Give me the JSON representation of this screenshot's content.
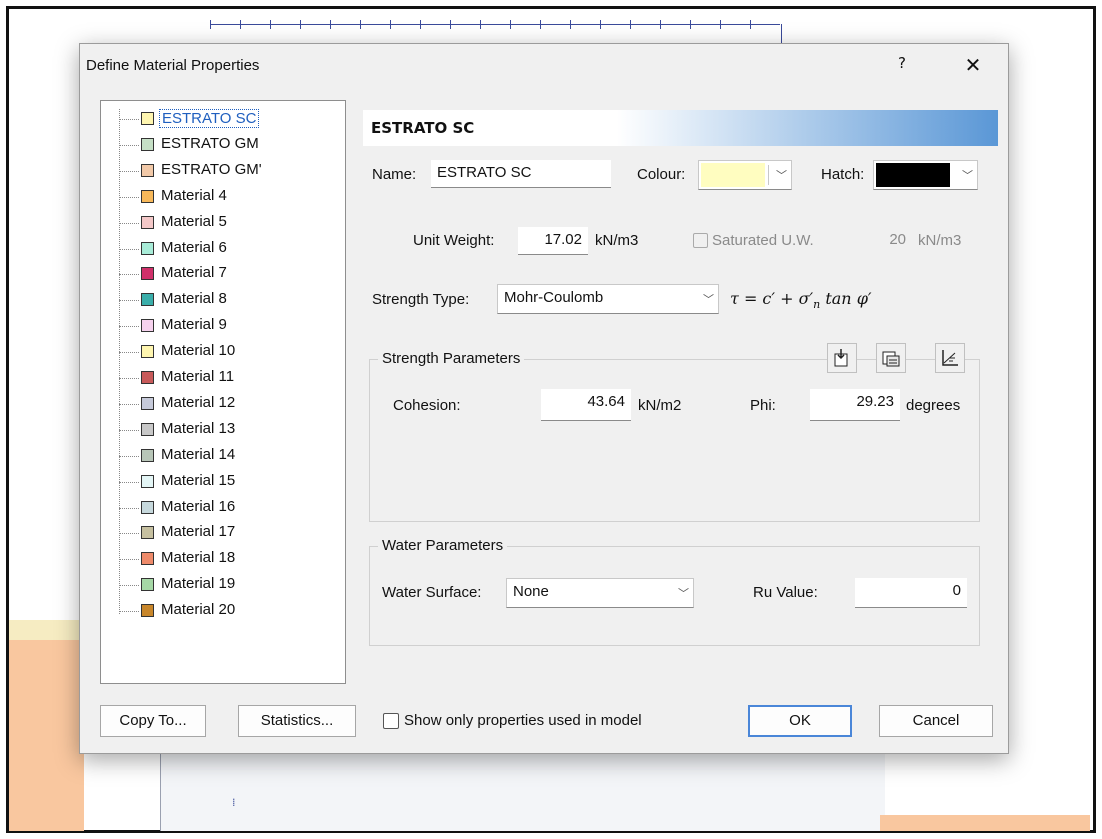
{
  "dialog": {
    "title": "Define Material Properties",
    "help_label": "?",
    "close_label": "✕"
  },
  "materials": [
    {
      "label": "ESTRATO SC",
      "color": "#fff6b0",
      "selected": true
    },
    {
      "label": "ESTRATO GM",
      "color": "#c6e0c6"
    },
    {
      "label": "ESTRATO GM'",
      "color": "#f2c9a8"
    },
    {
      "label": "Material 4",
      "color": "#f7b85a"
    },
    {
      "label": "Material 5",
      "color": "#f4c8c8"
    },
    {
      "label": "Material 6",
      "color": "#a8ecd8"
    },
    {
      "label": "Material 7",
      "color": "#d0306a"
    },
    {
      "label": "Material 8",
      "color": "#3aaeaa"
    },
    {
      "label": "Material 9",
      "color": "#f6d2ee"
    },
    {
      "label": "Material 10",
      "color": "#fff6b0"
    },
    {
      "label": "Material 11",
      "color": "#c85a5a"
    },
    {
      "label": "Material 12",
      "color": "#c6cada"
    },
    {
      "label": "Material 13",
      "color": "#c8c8c8"
    },
    {
      "label": "Material 14",
      "color": "#b8c6b8"
    },
    {
      "label": "Material 15",
      "color": "#e4f6f6"
    },
    {
      "label": "Material 16",
      "color": "#c6d8dc"
    },
    {
      "label": "Material 17",
      "color": "#c6c0a0"
    },
    {
      "label": "Material 18",
      "color": "#ee8a6a"
    },
    {
      "label": "Material 19",
      "color": "#a6d8a6"
    },
    {
      "label": "Material 20",
      "color": "#c8862a"
    }
  ],
  "header": {
    "title": "ESTRATO SC"
  },
  "name": {
    "label": "Name:",
    "value": "ESTRATO SC"
  },
  "colour": {
    "label": "Colour:",
    "value_color": "#fffdc0"
  },
  "hatch": {
    "label": "Hatch:",
    "value_color": "#000000"
  },
  "unit_weight": {
    "label": "Unit Weight:",
    "value": "17.02",
    "unit": "kN/m3"
  },
  "saturated": {
    "label": "Saturated U.W.",
    "value": "20",
    "unit": "kN/m3",
    "checked": false
  },
  "strength_type": {
    "label": "Strength Type:",
    "value": "Mohr-Coulomb"
  },
  "strength_params": {
    "title": "Strength Parameters",
    "cohesion_label": "Cohesion:",
    "cohesion_value": "43.64",
    "cohesion_unit": "kN/m2",
    "phi_label": "Phi:",
    "phi_value": "29.23",
    "phi_unit": "degrees"
  },
  "water_params": {
    "title": "Water Parameters",
    "surface_label": "Water Surface:",
    "surface_value": "None",
    "ru_label": "Ru Value:",
    "ru_value": "0"
  },
  "footer": {
    "copy_to": "Copy To...",
    "statistics": "Statistics...",
    "show_only": "Show only properties used in model",
    "ok": "OK",
    "cancel": "Cancel"
  }
}
